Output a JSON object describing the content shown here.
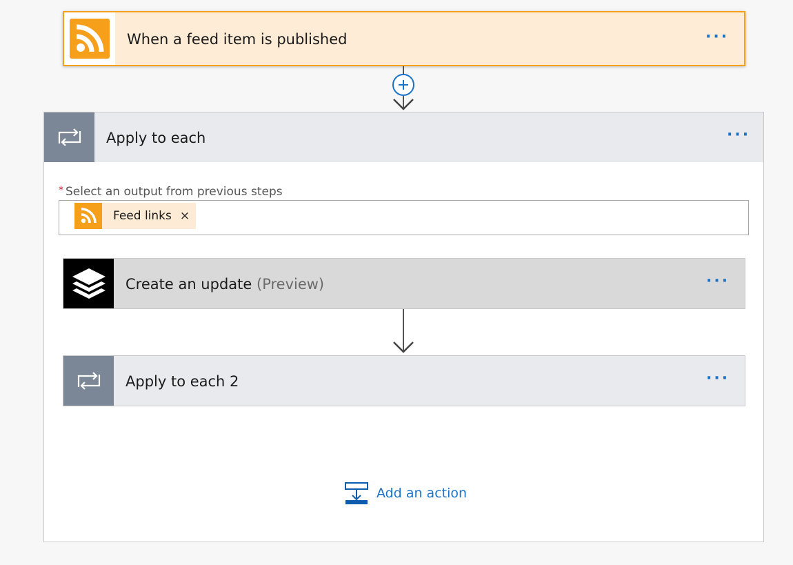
{
  "trigger": {
    "title": "When a feed item is published",
    "icon": "rss-icon",
    "more": "···"
  },
  "connector": {
    "add_step_icon": "plus-icon"
  },
  "loop": {
    "title": "Apply to each",
    "icon": "loop-icon",
    "more": "···",
    "field": {
      "required_mark": "*",
      "label": "Select an output from previous steps",
      "token": {
        "label": "Feed links",
        "icon": "rss-icon",
        "remove": "×"
      }
    },
    "actions": [
      {
        "title": "Create an update",
        "suffix": "(Preview)",
        "icon": "buffer-icon",
        "more": "···"
      },
      {
        "title": "Apply to each 2",
        "icon": "loop-icon",
        "more": "···"
      }
    ],
    "add_action": {
      "label": "Add an action",
      "icon": "add-action-icon"
    }
  },
  "colors": {
    "trigger_bg": "#feecd6",
    "trigger_border": "#f59f1b",
    "loop_icon_bg": "#7b8796",
    "link": "#1a73c8"
  }
}
